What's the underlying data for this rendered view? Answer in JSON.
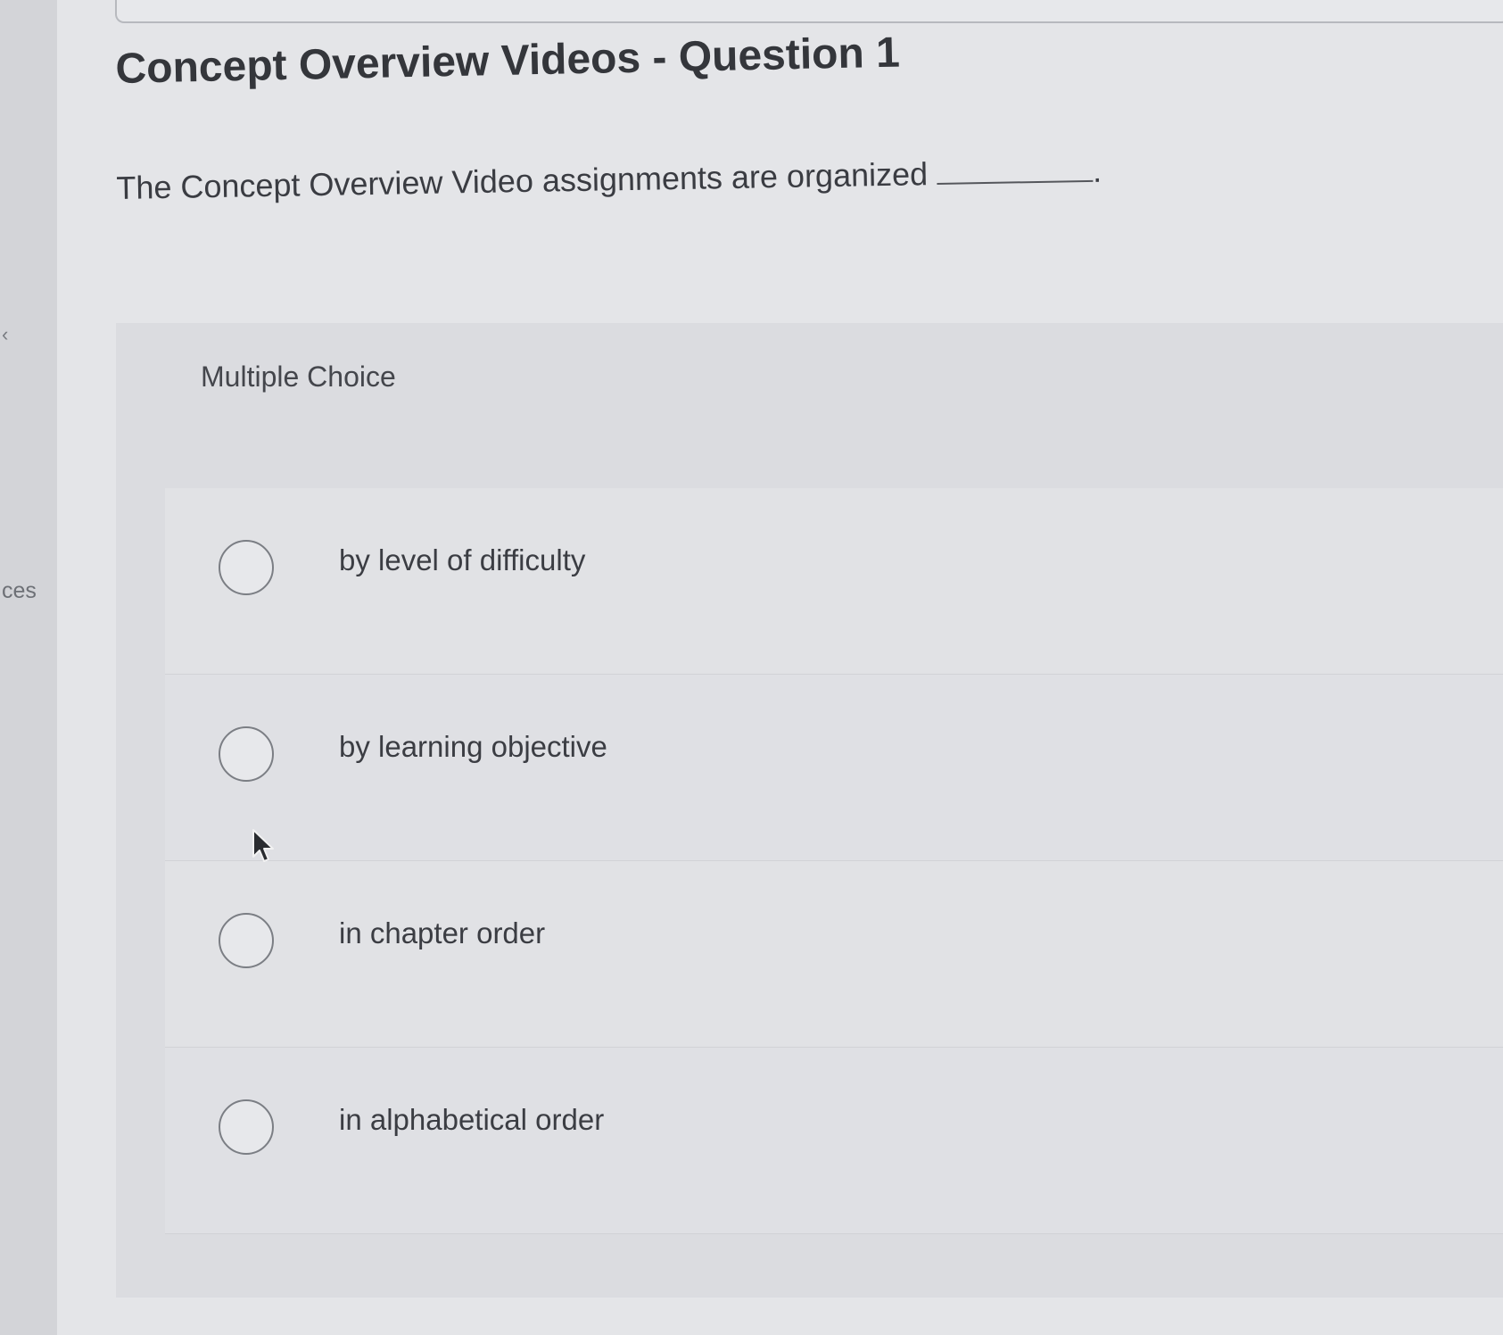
{
  "sidebar": {
    "collapse_glyph": "‹",
    "partial_label": "ces"
  },
  "question": {
    "title": "Concept Overview Videos - Question 1",
    "prompt": "The Concept Overview Video assignments are organized",
    "prompt_end": "."
  },
  "answer_panel": {
    "type_label": "Multiple Choice",
    "options": [
      {
        "label": "by level of difficulty"
      },
      {
        "label": "by learning objective"
      },
      {
        "label": "in chapter order"
      },
      {
        "label": "in alphabetical order"
      }
    ]
  },
  "icons": {
    "pointer": "mouse-pointer-icon",
    "radio": "radio-empty-icon"
  }
}
